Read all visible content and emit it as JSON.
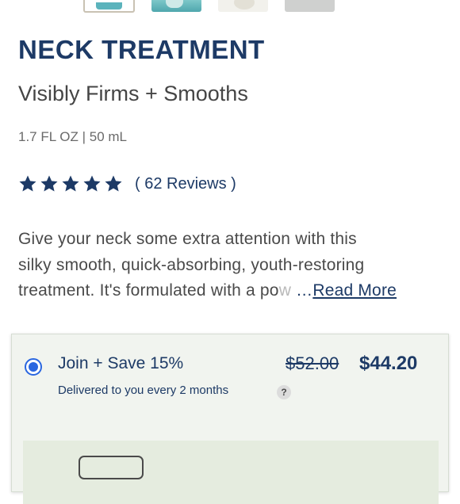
{
  "product": {
    "title": "NECK TREATMENT",
    "subtitle": "Visibly Firms + Smooths",
    "size": "1.7 FL OZ | 50 mL",
    "rating": 5,
    "reviews_label": "( 62 Reviews )",
    "description": {
      "line1": "Give your neck some extra attention with this",
      "line2": "silky smooth, quick-absorbing, youth-restoring",
      "line3": "treatment. It's formulated with a po",
      "line3_faded": "w",
      "ellipsis": "…",
      "read_more": "Read More"
    }
  },
  "subscription": {
    "title": "Join + Save 15%",
    "price_old": "$52.00",
    "price_new": "$44.20",
    "delivery": "Delivered to you every 2 months",
    "help": "?"
  },
  "icons": {
    "star": "star-icon",
    "help": "question-icon"
  },
  "colors": {
    "brand_navy": "#1d3a66",
    "radio_blue": "#2a66e0",
    "card_bg": "#f1f4ef"
  }
}
